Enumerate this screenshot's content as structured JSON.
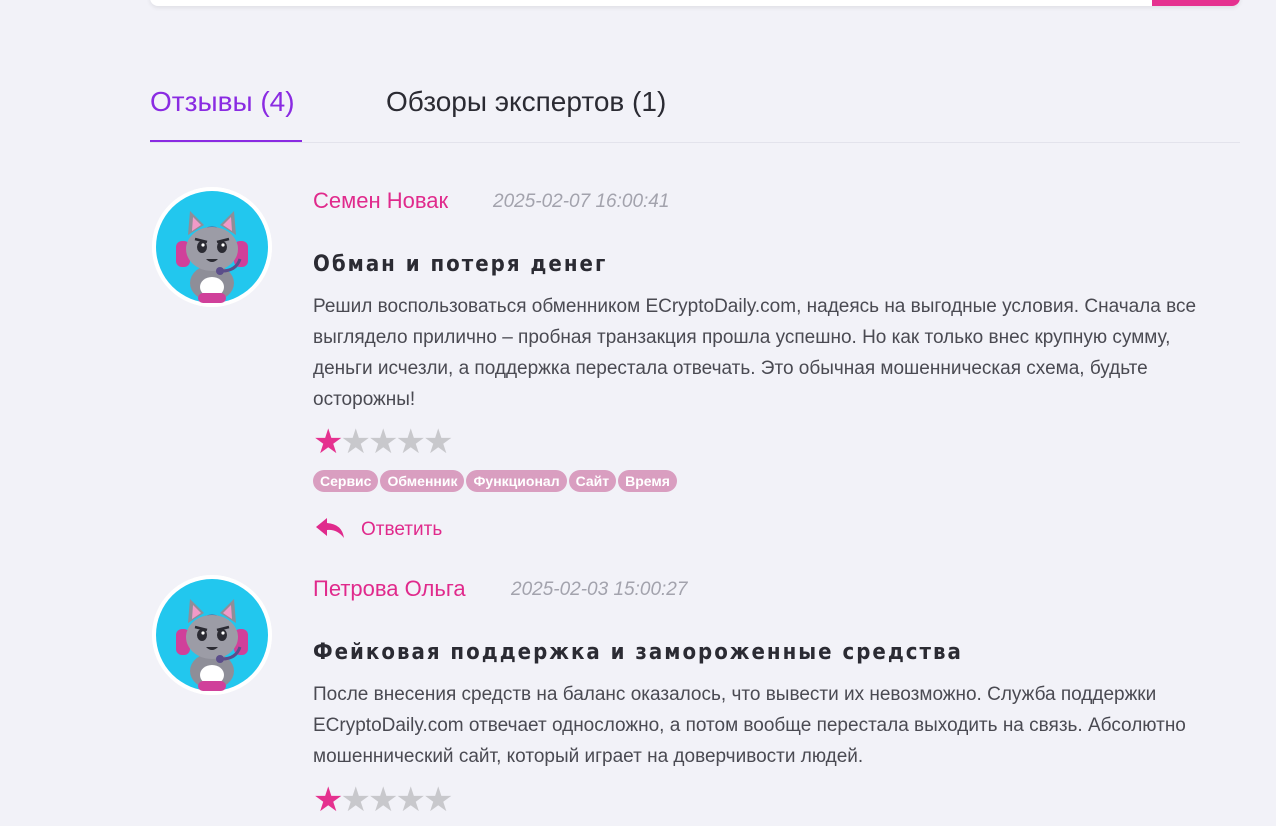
{
  "colors": {
    "accent_pink": "#e5318f",
    "tab_active": "#8a2be2",
    "tag_bg": "#d99ec0",
    "background": "#f2f2f8",
    "avatar_ring": "#22c7ee"
  },
  "tabs": [
    {
      "label": "Отзывы (4)",
      "active": true
    },
    {
      "label": "Обзоры экспертов (1)",
      "active": false
    }
  ],
  "reviews": [
    {
      "author": "Семен Новак",
      "date": "2025-02-07 16:00:41",
      "title": "Обман и потеря денег",
      "text": "Решил воспользоваться обменником ECryptoDaily.com, надеясь на выгодные условия. Сначала все выглядело прилично – пробная транзакция прошла успешно. Но как только внес крупную сумму, деньги исчезли, а поддержка перестала отвечать. Это обычная мошенническая схема, будьте осторожны!",
      "rating": 1,
      "rating_max": 5,
      "tags": [
        "Сервис",
        "Обменник",
        "Функционал",
        "Сайт",
        "Время"
      ],
      "reply_label": "Ответить",
      "avatar_icon": "cat-gamer-icon"
    },
    {
      "author": "Петрова Ольга",
      "date": "2025-02-03 15:00:27",
      "title": "Фейковая поддержка и замороженные средства",
      "text": "После внесения средств на баланс оказалось, что вывести их невозможно. Служба поддержки ECryptoDaily.com отвечает односложно, а потом вообще перестала выходить на связь. Абсолютно мошеннический сайт, который играет на доверчивости людей.",
      "rating": 1,
      "rating_max": 5,
      "avatar_icon": "cat-gamer-icon"
    }
  ]
}
